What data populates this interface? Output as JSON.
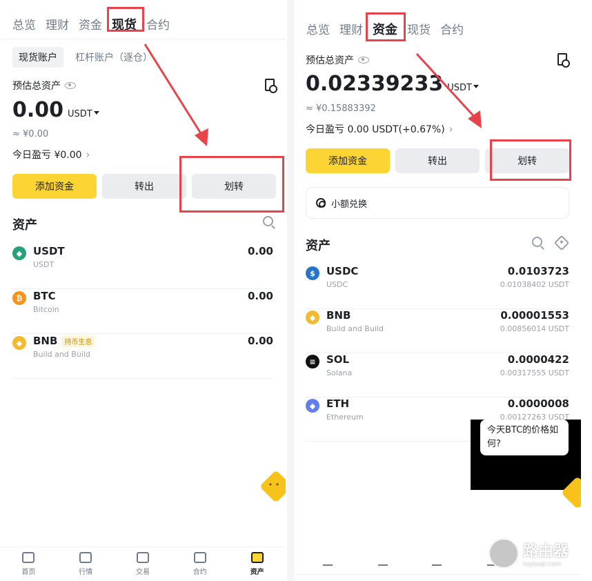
{
  "left": {
    "tabs": [
      "总览",
      "理财",
      "资金",
      "现货",
      "合约"
    ],
    "active_tab": "现货",
    "subtabs": [
      "现货账户",
      "杠杆账户（逐仓）"
    ],
    "est_label": "预估总资产",
    "total": "0.00",
    "unit": "USDT",
    "approx": "≈ ¥0.00",
    "pnl": "今日盈亏 ¥0.00",
    "buttons": {
      "deposit": "添加资金",
      "withdraw": "转出",
      "transfer": "划转"
    },
    "assets_title": "资产",
    "assets": [
      {
        "symbol": "USDT",
        "name": "USDT",
        "value": "0.00",
        "tag": "",
        "color": "#26a17b"
      },
      {
        "symbol": "BTC",
        "name": "Bitcoin",
        "value": "0.00",
        "tag": "",
        "color": "#f7931a"
      },
      {
        "symbol": "BNB",
        "name": "Build and Build",
        "value": "0.00",
        "tag": "持币生息",
        "color": "#f3ba2f"
      }
    ],
    "nav": [
      "首页",
      "行情",
      "交易",
      "合约",
      "资产"
    ]
  },
  "right": {
    "tabs": [
      "总览",
      "理财",
      "资金",
      "现货",
      "合约"
    ],
    "active_tab": "资金",
    "est_label": "预估总资产",
    "total": "0.02339233",
    "unit": "USDT",
    "approx": "≈ ¥0.15883392",
    "pnl": "今日盈亏 0.00 USDT(+0.67%)",
    "buttons": {
      "deposit": "添加资金",
      "withdraw": "转出",
      "transfer": "划转"
    },
    "small_exchange": "小额兑换",
    "assets_title": "资产",
    "assets": [
      {
        "symbol": "USDC",
        "name": "USDC",
        "value": "0.0103723",
        "usd": "0.01038402 USDT",
        "color": "#2775ca"
      },
      {
        "symbol": "BNB",
        "name": "Build and Build",
        "value": "0.00001553",
        "usd": "0.00856014 USDT",
        "color": "#f3ba2f"
      },
      {
        "symbol": "SOL",
        "name": "Solana",
        "value": "0.0000422",
        "usd": "0.00317555 USDT",
        "color": "#111111"
      },
      {
        "symbol": "ETH",
        "name": "Ethereum",
        "value": "0.0000008",
        "usd": "0.00127263 USDT",
        "color": "#627eea"
      }
    ],
    "chat_bubble": "今天BTC的价格如何?",
    "watermark": {
      "text": "路由器",
      "sub": "luyouqi.com"
    }
  },
  "colors": {
    "accent": "#fcd535",
    "highlight": "#e8434a"
  }
}
